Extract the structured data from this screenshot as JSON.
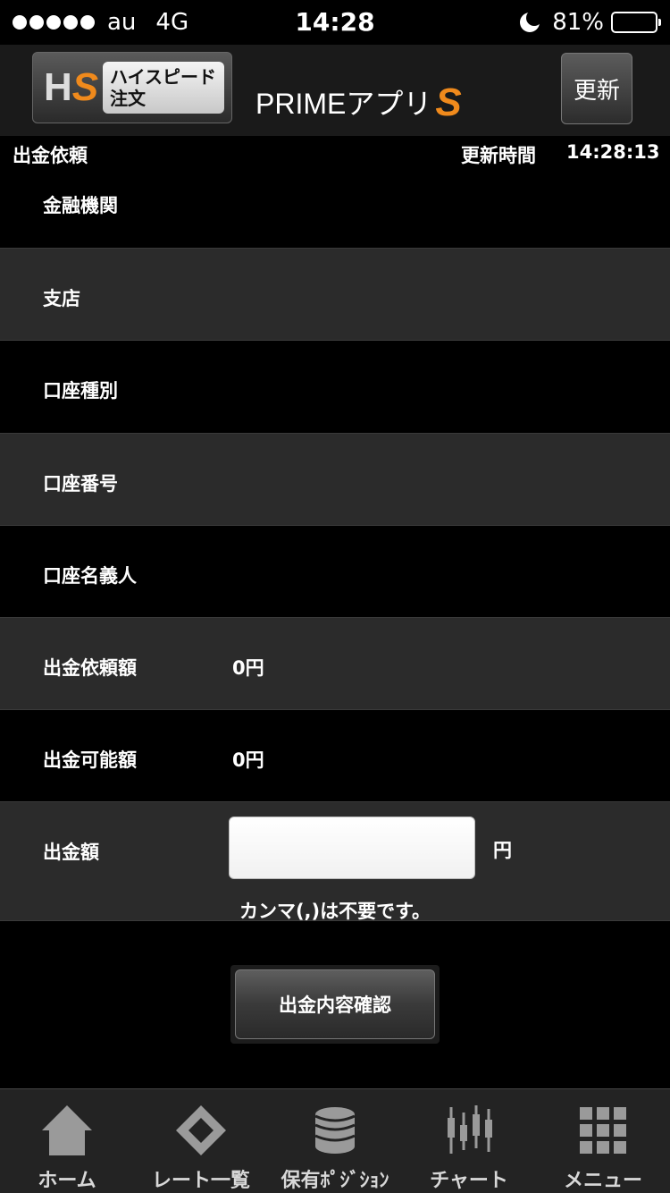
{
  "status_bar": {
    "carrier": "au",
    "network": "4G",
    "time": "14:28",
    "battery_percent": "81%",
    "battery_level": 0.81
  },
  "header": {
    "logo_letters_h": "H",
    "logo_letters_s": "S",
    "logo_box_line1": "ハイスピード",
    "logo_box_line2": "注文",
    "app_title": "PRIMEアプリ",
    "app_title_s": "S",
    "refresh_label": "更新"
  },
  "subheader": {
    "title": "出金依頼",
    "updated_label": "更新時間",
    "updated_time": "14:28:13"
  },
  "form": {
    "rows": [
      {
        "label": "金融機関",
        "value": ""
      },
      {
        "label": "支店",
        "value": ""
      },
      {
        "label": "口座種別",
        "value": ""
      },
      {
        "label": "口座番号",
        "value": ""
      },
      {
        "label": "口座名義人",
        "value": ""
      },
      {
        "label": "出金依頼額",
        "value": "0円"
      },
      {
        "label": "出金可能額",
        "value": "0円"
      }
    ],
    "amount_label": "出金額",
    "amount_value": "",
    "amount_unit": "円",
    "comma_note": "カンマ(,)は不要です。",
    "confirm_label": "出金内容確認"
  },
  "tabbar": {
    "tabs": [
      {
        "label": "ホーム",
        "icon": "home-icon"
      },
      {
        "label": "レート一覧",
        "icon": "rates-icon"
      },
      {
        "label": "保有ﾎﾟｼﾞｼｮﾝ",
        "icon": "positions-icon"
      },
      {
        "label": "チャート",
        "icon": "chart-icon"
      },
      {
        "label": "メニュー",
        "icon": "menu-grid-icon"
      }
    ]
  },
  "colors": {
    "accent": "#f08a1c",
    "row_light": "#2b2b2b",
    "background": "#000000"
  }
}
